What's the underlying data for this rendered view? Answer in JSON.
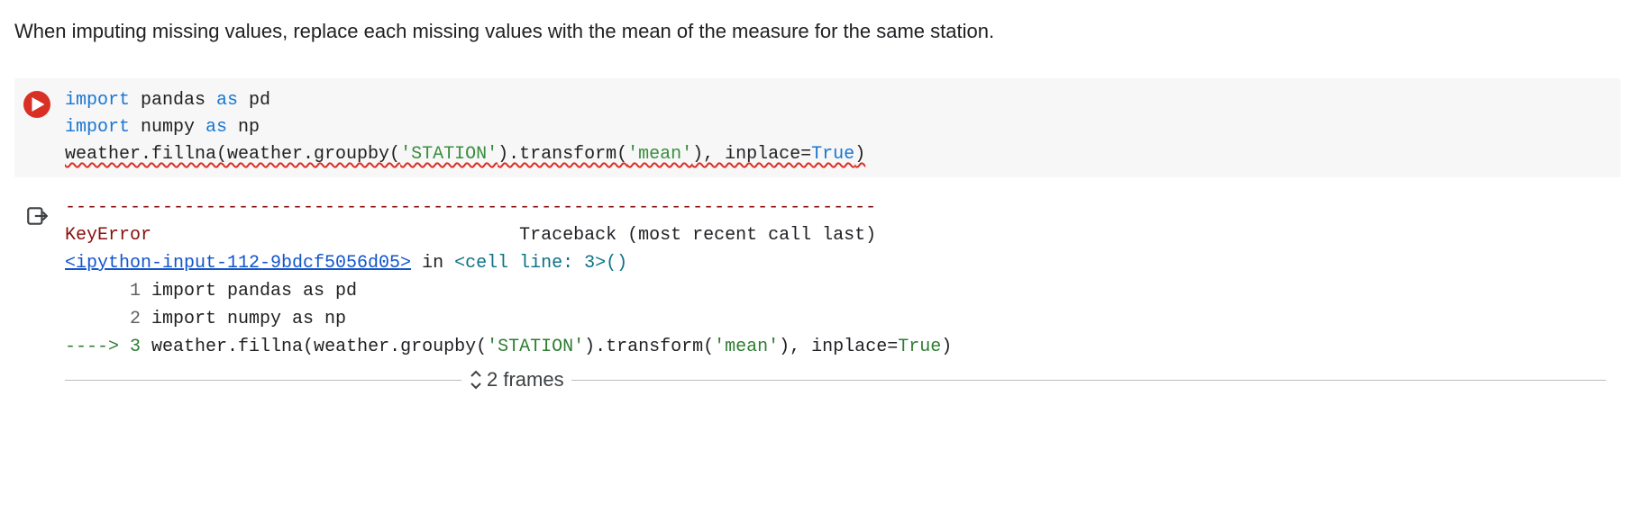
{
  "prompt_text": "When imputing missing values, replace each missing values with the mean of the measure for the same station.",
  "code": {
    "kw_import1": "import",
    "lib1": " pandas ",
    "kw_as1": "as",
    "alias1": " pd",
    "kw_import2": "import",
    "lib2": " numpy ",
    "kw_as2": "as",
    "alias2": " np",
    "line3a": "weather.fillna(weather.groupby(",
    "line3_str1": "'STATION'",
    "line3b": ").transform(",
    "line3_str2": "'mean'",
    "line3c": "), inplace=",
    "line3_true": "True",
    "line3d": ")"
  },
  "traceback": {
    "sep": "---------------------------------------------------------------------------",
    "err_name": "KeyError",
    "space_pad": "                                  ",
    "tb_label": "Traceback (most recent call last)",
    "ref": "<ipython-input-112-9bdcf5056d05>",
    "in": " in ",
    "loc": "<cell line: 3>",
    "paren": "()",
    "n1": "      1 ",
    "l1": "import pandas as pd",
    "n2": "      2 ",
    "l2": "import numpy as np",
    "arrow": "----> ",
    "n3": "3 ",
    "l3a": "weather.fillna(weather.groupby(",
    "l3s1": "'STATION'",
    "l3b": ").transform(",
    "l3s2": "'mean'",
    "l3c": "), inplace=",
    "l3true": "True",
    "l3d": ")"
  },
  "frames_label": "2 frames"
}
